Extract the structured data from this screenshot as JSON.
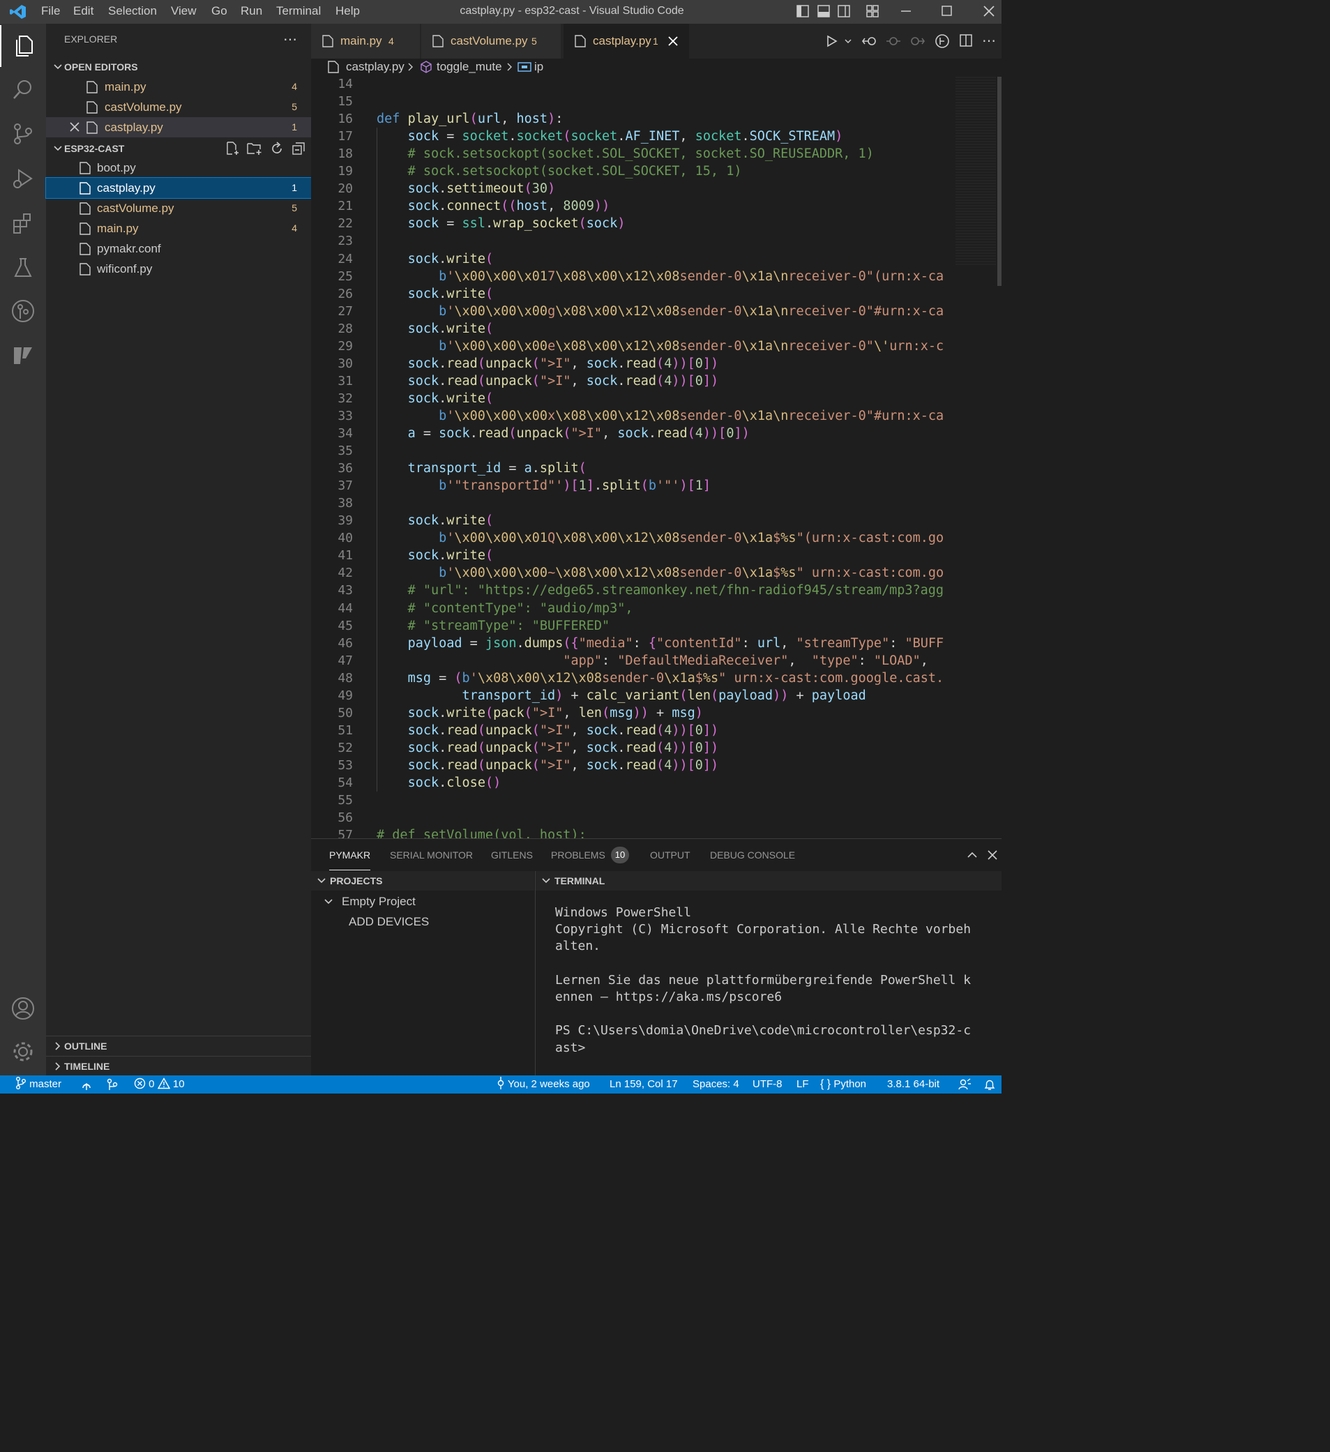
{
  "window": {
    "title": "castplay.py - esp32-cast - Visual Studio Code",
    "menu": [
      "File",
      "Edit",
      "Selection",
      "View",
      "Go",
      "Run",
      "Terminal",
      "Help"
    ]
  },
  "sidebar": {
    "title": "EXPLORER",
    "open_editors_label": "OPEN EDITORS",
    "open_editors": [
      {
        "name": "main.py",
        "badge": "4"
      },
      {
        "name": "castVolume.py",
        "badge": "5"
      },
      {
        "name": "castplay.py",
        "badge": "1"
      }
    ],
    "project_label": "ESP32-CAST",
    "files": [
      {
        "name": "boot.py",
        "badge": ""
      },
      {
        "name": "castplay.py",
        "badge": "1"
      },
      {
        "name": "castVolume.py",
        "badge": "5"
      },
      {
        "name": "main.py",
        "badge": "4"
      },
      {
        "name": "pymakr.conf",
        "badge": ""
      },
      {
        "name": "wificonf.py",
        "badge": ""
      }
    ],
    "outline_label": "OUTLINE",
    "timeline_label": "TIMELINE"
  },
  "tabs": [
    {
      "name": "main.py",
      "badge": "4"
    },
    {
      "name": "castVolume.py",
      "badge": "5"
    },
    {
      "name": "castplay.py",
      "badge": "1"
    }
  ],
  "breadcrumb": [
    "castplay.py",
    "toggle_mute",
    "ip"
  ],
  "editor": {
    "line_numbers": [
      "14",
      "15",
      "16",
      "17",
      "18",
      "19",
      "20",
      "21",
      "22",
      "23",
      "24",
      "25",
      "26",
      "27",
      "28",
      "29",
      "30",
      "31",
      "32",
      "33",
      "34",
      "35",
      "36",
      "37",
      "38",
      "39",
      "40",
      "41",
      "42",
      "43",
      "44",
      "45",
      "46",
      "47",
      "48",
      "49",
      "50",
      "51",
      "52",
      "53",
      "54",
      "55",
      "56",
      "57"
    ],
    "lines": [
      "",
      "",
      "def play_url(url, host):",
      "    sock = socket.socket(socket.AF_INET, socket.SOCK_STREAM)",
      "    # sock.setsockopt(socket.SOL_SOCKET, socket.SO_REUSEADDR, 1)",
      "    # sock.setsockopt(socket.SOL_SOCKET, 15, 1)",
      "    sock.settimeout(30)",
      "    sock.connect((host, 8009))",
      "    sock = ssl.wrap_socket(sock)",
      "",
      "    sock.write(",
      "        b'\\x00\\x00\\x017\\x08\\x00\\x12\\x08sender-0\\x1a\\nreceiver-0\"(urn:x-ca",
      "    sock.write(",
      "        b'\\x00\\x00\\x00g\\x08\\x00\\x12\\x08sender-0\\x1a\\nreceiver-0\"#urn:x-ca",
      "    sock.write(",
      "        b'\\x00\\x00\\x00e\\x08\\x00\\x12\\x08sender-0\\x1a\\nreceiver-0\"\\'urn:x-c",
      "    sock.read(unpack(\">I\", sock.read(4))[0])",
      "    sock.read(unpack(\">I\", sock.read(4))[0])",
      "    sock.write(",
      "        b'\\x00\\x00\\x00x\\x08\\x00\\x12\\x08sender-0\\x1a\\nreceiver-0\"#urn:x-ca",
      "    a = sock.read(unpack(\">I\", sock.read(4))[0])",
      "",
      "    transport_id = a.split(",
      "        b'\"transportId\"')[1].split(b'\"')[1]",
      "",
      "    sock.write(",
      "        b'\\x00\\x00\\x01Q\\x08\\x00\\x12\\x08sender-0\\x1a$%s\"(urn:x-cast:com.go",
      "    sock.write(",
      "        b'\\x00\\x00\\x00~\\x08\\x00\\x12\\x08sender-0\\x1a$%s\" urn:x-cast:com.go",
      "    # \"url\": \"https://edge65.streamonkey.net/fhn-radiof945/stream/mp3?agg",
      "    # \"contentType\": \"audio/mp3\",",
      "    # \"streamType\": \"BUFFERED\"",
      "    payload = json.dumps({\"media\": {\"contentId\": url, \"streamType\": \"BUFF",
      "                        \"app\": \"DefaultMediaReceiver\",  \"type\": \"LOAD\",",
      "    msg = (b'\\x08\\x00\\x12\\x08sender-0\\x1a$%s\" urn:x-cast:com.google.cast.",
      "           transport_id) + calc_variant(len(payload)) + payload",
      "    sock.write(pack(\">I\", len(msg)) + msg)",
      "    sock.read(unpack(\">I\", sock.read(4))[0])",
      "    sock.read(unpack(\">I\", sock.read(4))[0])",
      "    sock.read(unpack(\">I\", sock.read(4))[0])",
      "    sock.close()",
      "",
      "",
      "# def setVolume(vol, host):"
    ]
  },
  "panel": {
    "tabs": [
      "PYMAKR",
      "SERIAL MONITOR",
      "GITLENS",
      "PROBLEMS",
      "OUTPUT",
      "DEBUG CONSOLE"
    ],
    "problems_count": "10",
    "projects_label": "PROJECTS",
    "project_name": "Empty Project",
    "add_devices": "ADD DEVICES",
    "terminal_label": "TERMINAL",
    "terminal_lines": [
      "Windows PowerShell",
      "Copyright (C) Microsoft Corporation. Alle Rechte vorbeh",
      "alten.",
      "",
      "Lernen Sie das neue plattformübergreifende PowerShell k",
      "ennen – https://aka.ms/pscore6",
      "",
      "PS C:\\Users\\domia\\OneDrive\\code\\microcontroller\\esp32-c",
      "ast>"
    ]
  },
  "status": {
    "branch": "master",
    "errors": "0",
    "warnings": "10",
    "blame": "You, 2 weeks ago",
    "position": "Ln 159, Col 17",
    "spaces": "Spaces: 4",
    "encoding": "UTF-8",
    "eol": "LF",
    "language": "Python",
    "interpreter": "3.8.1 64-bit"
  },
  "colors": {
    "accent": "#007acc",
    "modified": "#e2c08d",
    "selection": "#094771"
  }
}
